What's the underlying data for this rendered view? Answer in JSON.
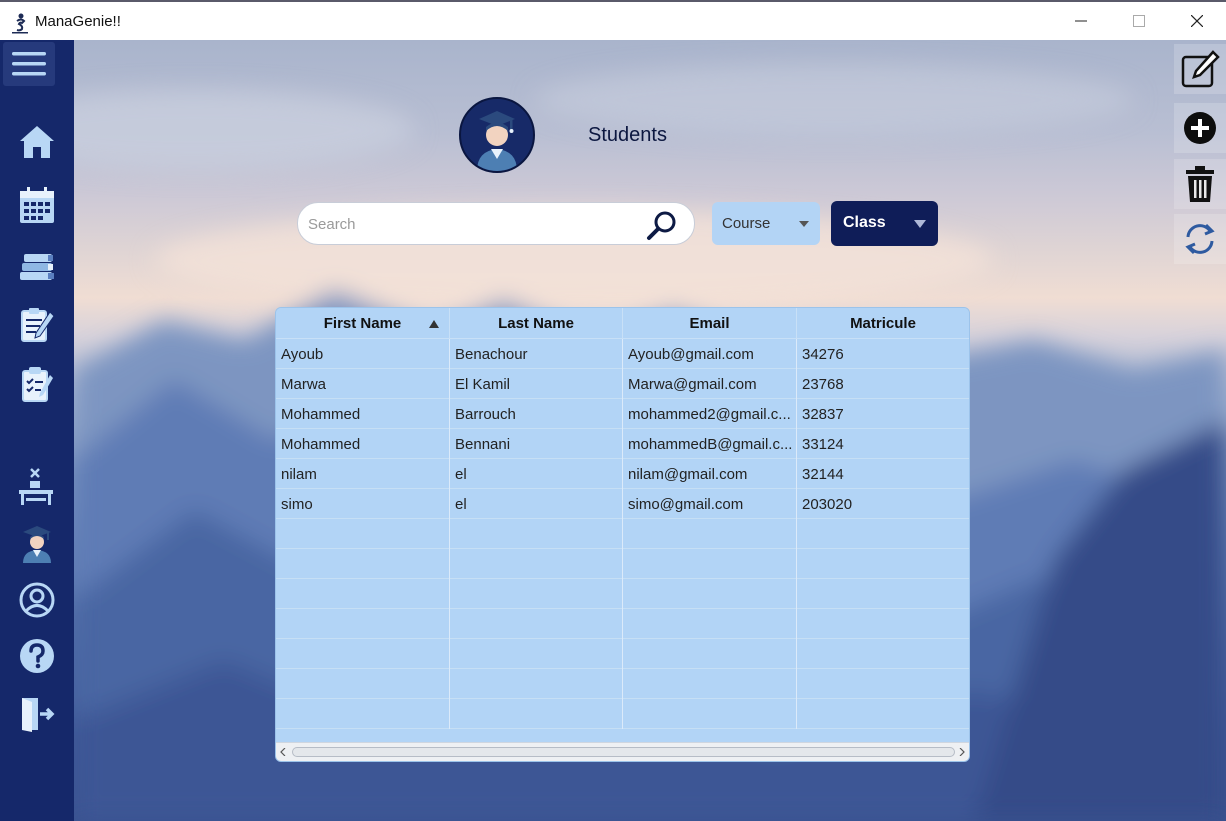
{
  "window": {
    "title": "ManaGenie!!",
    "controls": [
      "minimize-icon",
      "maximize-icon",
      "close-icon"
    ]
  },
  "sidebar": {
    "menu_icon": "hamburger-menu-icon",
    "items": [
      {
        "name": "home",
        "icon": "home-icon"
      },
      {
        "name": "calendar",
        "icon": "calendar-icon"
      },
      {
        "name": "courses",
        "icon": "books-icon"
      },
      {
        "name": "assignments",
        "icon": "document-edit-icon"
      },
      {
        "name": "exams",
        "icon": "clipboard-check-icon"
      },
      {
        "name": "classrooms",
        "icon": "desk-icon"
      },
      {
        "name": "students",
        "icon": "student-icon"
      },
      {
        "name": "profile",
        "icon": "user-circle-icon"
      },
      {
        "name": "help",
        "icon": "help-icon"
      },
      {
        "name": "logout",
        "icon": "logout-icon"
      }
    ],
    "colors": {
      "background": "#15286a",
      "icon": "#b8d7f5"
    }
  },
  "toolbar_right": [
    {
      "name": "edit",
      "icon": "edit-icon"
    },
    {
      "name": "add",
      "icon": "add-circle-icon"
    },
    {
      "name": "delete",
      "icon": "trash-icon"
    },
    {
      "name": "refresh",
      "icon": "refresh-icon"
    }
  ],
  "header": {
    "title": "Students",
    "avatar_icon": "student-avatar-icon"
  },
  "filters": {
    "search_placeholder": "Search",
    "search_value": "",
    "course_label": "Course",
    "class_label": "Class"
  },
  "table": {
    "columns": [
      "First Name",
      "Last Name",
      "Email",
      "Matricule"
    ],
    "sorted_column": "First Name",
    "sort_direction": "ascending",
    "rows": [
      [
        "Ayoub",
        "Benachour",
        "Ayoub@gmail.com",
        "34276"
      ],
      [
        "Marwa",
        "El Kamil",
        "Marwa@gmail.com",
        "23768"
      ],
      [
        "Mohammed",
        "Barrouch",
        "mohammed2@gmail.c...",
        "32837"
      ],
      [
        "Mohammed",
        "Bennani",
        "mohammedB@gmail.c...",
        "33124"
      ],
      [
        "nilam",
        "el",
        "nilam@gmail.com",
        "32144"
      ],
      [
        "simo",
        "el",
        "simo@gmail.com",
        "203020"
      ]
    ],
    "empty_rows": 7
  },
  "colors": {
    "accent_dark": "#0f1d58",
    "table_bg": "#b2d4f6",
    "course_select_bg": "#b3d4f5"
  }
}
